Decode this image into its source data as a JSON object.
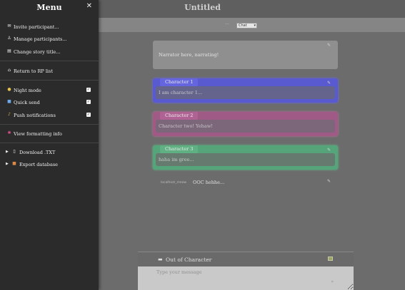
{
  "app": {
    "title": "Untitled"
  },
  "filter": {
    "label": "···",
    "selected": "Chat"
  },
  "messages": {
    "narrator": {
      "text": "Narrator here, narrating!"
    },
    "character1": {
      "name": "Character 1",
      "text": "I am character 1..."
    },
    "character2": {
      "name": "Character 2",
      "text": "Character two! Yehaw!"
    },
    "character3": {
      "name": "Character 3",
      "text": "haha im gree..."
    },
    "ooc": {
      "name": "localhost_meow",
      "text": "OOC hehhe..."
    }
  },
  "composer": {
    "label": "Out of Character",
    "placeholder": "Type your message",
    "send_glyph": "»"
  },
  "menu": {
    "title": "Menu",
    "close_glyph": "✕",
    "items": {
      "invite": "Invite participant...",
      "manage": "Manage participants...",
      "change_title": "Change story title...",
      "return": "Return to RP list",
      "night_mode": "Night mode",
      "quick_send": "Quick send",
      "push": "Push notifications",
      "formatting": "View formatting info",
      "download": "Download .TXT",
      "export": "Export database"
    },
    "toggles": {
      "night_mode": true,
      "quick_send": true,
      "push": true
    }
  },
  "colors": {
    "character1": "#5a5ad0",
    "character2": "#a05a86",
    "character3": "#56a47a",
    "menu_bg": "#2b2b2b"
  }
}
